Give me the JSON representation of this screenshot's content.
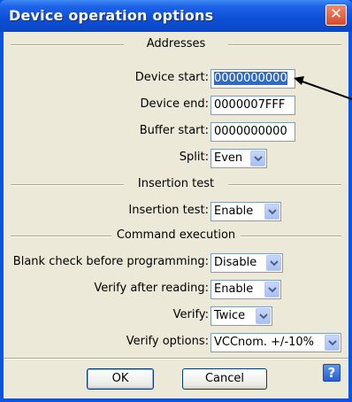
{
  "window": {
    "title": "Device operation options",
    "close_glyph": "✕"
  },
  "sections": {
    "addresses": "Addresses",
    "insertion": "Insertion test",
    "command": "Command execution"
  },
  "fields": {
    "device_start": {
      "label": "Device start:",
      "value": "0000000000"
    },
    "device_end": {
      "label": "Device end:",
      "value": "0000007FFF"
    },
    "buffer_start": {
      "label": "Buffer start:",
      "value": "0000000000"
    },
    "split": {
      "label": "Split:",
      "value": "Even"
    },
    "insertion_test": {
      "label": "Insertion test:",
      "value": "Enable"
    },
    "blank_check": {
      "label": "Blank check before programming:",
      "value": "Disable"
    },
    "verify_after_reading": {
      "label": "Verify after reading:",
      "value": "Enable"
    },
    "verify": {
      "label": "Verify:",
      "value": "Twice"
    },
    "verify_options": {
      "label": "Verify options:",
      "value": "VCCnom. +/-10%"
    }
  },
  "buttons": {
    "ok": "OK",
    "cancel": "Cancel",
    "help": "?"
  },
  "icons": {
    "close": "close-icon",
    "help": "help-icon",
    "dropdown": "chevron-down-icon",
    "pointer": "arrow-icon"
  },
  "colors": {
    "titlebar": "#0a54e3",
    "client": "#ece9d8",
    "selection": "#316ac5",
    "close_button": "#d9482a"
  }
}
